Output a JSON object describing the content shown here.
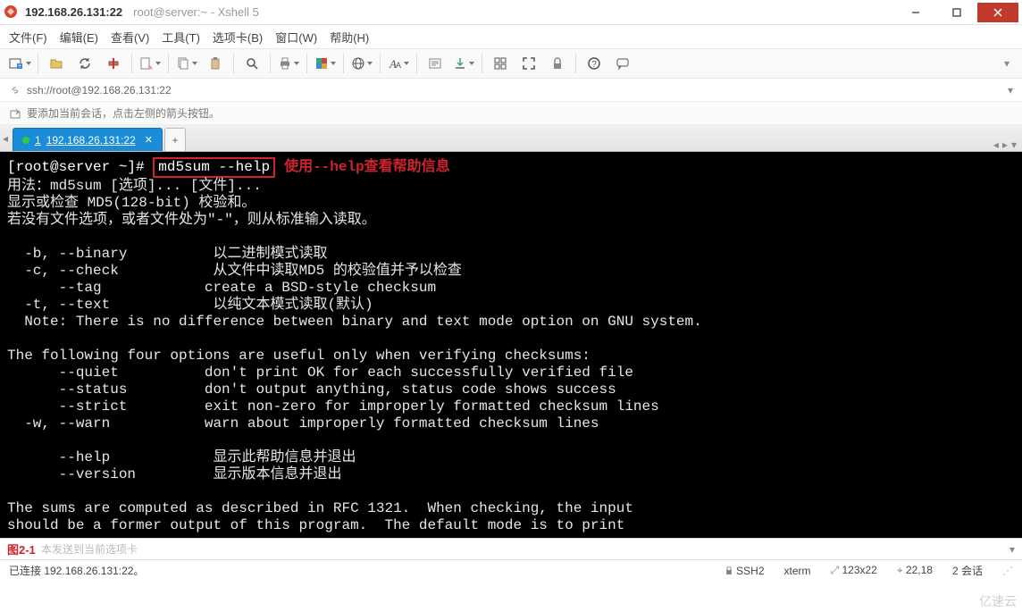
{
  "titlebar": {
    "address": "192.168.26.131:22",
    "subtitle": "root@server:~ - Xshell 5"
  },
  "menubar": {
    "file": "文件(F)",
    "edit": "编辑(E)",
    "view": "查看(V)",
    "tools": "工具(T)",
    "tabs": "选项卡(B)",
    "window": "窗口(W)",
    "help": "帮助(H)"
  },
  "addressbar": {
    "url": "ssh://root@192.168.26.131:22"
  },
  "hintbar": {
    "text": "要添加当前会话，点击左侧的箭头按钮。"
  },
  "tab": {
    "index": "1",
    "label": "192.168.26.131:22"
  },
  "terminal": {
    "prompt": "[root@server ~]#",
    "command": "md5sum --help",
    "annotation": "使用--help查看帮助信息",
    "lines": [
      "用法：md5sum [选项]... [文件]...",
      "显示或检查 MD5(128-bit) 校验和。",
      "若没有文件选项，或者文件处为\"-\"，则从标准输入读取。",
      "",
      "  -b, --binary          以二进制模式读取",
      "  -c, --check           从文件中读取MD5 的校验值并予以检查",
      "      --tag            create a BSD-style checksum",
      "  -t, --text            以纯文本模式读取(默认)",
      "  Note: There is no difference between binary and text mode option on GNU system.",
      "",
      "The following four options are useful only when verifying checksums:",
      "      --quiet          don't print OK for each successfully verified file",
      "      --status         don't output anything, status code shows success",
      "      --strict         exit non-zero for improperly formatted checksum lines",
      "  -w, --warn           warn about improperly formatted checksum lines",
      "",
      "      --help            显示此帮助信息并退出",
      "      --version         显示版本信息并退出",
      "",
      "The sums are computed as described in RFC 1321.  When checking, the input",
      "should be a former output of this program.  The default mode is to print"
    ]
  },
  "inputbar": {
    "figure": "图2-1",
    "placeholder": "本发送到当前选项卡"
  },
  "statusbar": {
    "connection": "已连接 192.168.26.131:22。",
    "protocol": "SSH2",
    "termtype": "xterm",
    "size": "123x22",
    "cursor": "22,18",
    "sessions": "2 会话"
  },
  "watermark": "亿速云",
  "icons": {
    "app": "app-icon",
    "link": "link-icon",
    "arrow": "arrow-icon",
    "lock": "lock-icon",
    "ssh": "ssh-icon",
    "kb": "keyboard-icon",
    "sz": "size-icon",
    "cur": "cursor-icon"
  }
}
